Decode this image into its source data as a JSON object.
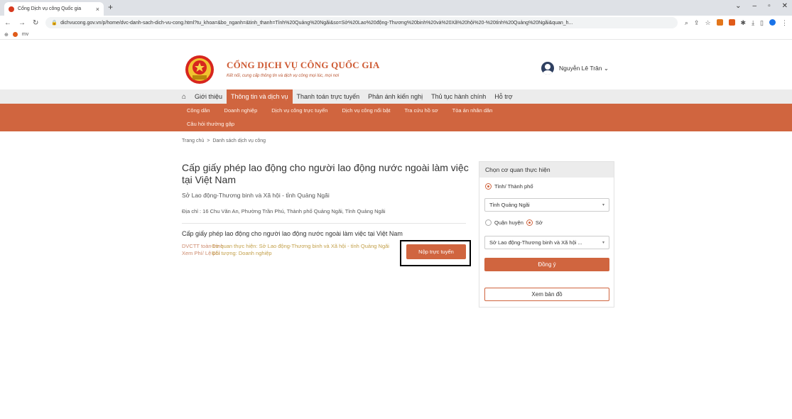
{
  "browser": {
    "tab_title": "Cổng Dịch vụ công Quốc gia",
    "tab_close": "×",
    "new_tab": "+",
    "url": "dichvucong.gov.vn/p/home/dvc-danh-sach-dich-vu-cong.html?tu_khoa=&bo_nganh=&tinh_thanh=Tỉnh%20Quảng%20Ngãi&so=Sở%20Lao%20động-Thương%20binh%20và%20Xã%20hội%20-%20tỉnh%20Quảng%20Ngãi&quan_h...",
    "bookmark_label": "mv"
  },
  "header": {
    "brand_title": "CỔNG DỊCH VỤ CÔNG QUỐC GIA",
    "brand_subtitle": "Kết nối, cung cấp thông tin và dịch vụ công mọi lúc, mọi nơi",
    "user_name": "Nguyễn Lê Trân ⌄"
  },
  "main_nav": {
    "items": [
      "Giới thiệu",
      "Thông tin và dịch vụ",
      "Thanh toán trực tuyến",
      "Phản ánh kiến nghị",
      "Thủ tục hành chính",
      "Hỗ trợ"
    ]
  },
  "sub_nav": {
    "row1": [
      "Công dân",
      "Doanh nghiệp",
      "Dịch vụ công trực tuyến",
      "Dịch vụ công nổi bật",
      "Tra cứu hồ sơ",
      "Tòa án nhân dân"
    ],
    "row2": [
      "Câu hỏi thường gặp"
    ]
  },
  "breadcrumb": {
    "home": "Trang chủ",
    "sep": ">",
    "current": "Danh sách dịch vụ công"
  },
  "service": {
    "title": "Cấp giấy phép lao động cho người lao động nước ngoài làm việc tại Việt Nam",
    "agency": "Sở Lao động-Thương binh và Xã hội - tỉnh Quảng Ngãi",
    "address": "Địa chỉ : 16 Chu Văn An, Phường Trần Phú, Thành phố Quảng Ngãi, Tỉnh Quảng Ngãi",
    "procedure_title": "Cấp giấy phép lao động cho người lao động nước ngoài làm việc tại Việt Nam",
    "dvctt_label": "DVCTT toàn trình",
    "fee_label": "Xem Phí/ Lệ phí",
    "agency_line": "Cơ quan thực hiện: Sở Lao động-Thương binh và Xã hội - tỉnh Quảng Ngãi",
    "target_line": "Đối tượng: Doanh nghiệp",
    "submit_button": "Nộp trực tuyến"
  },
  "panel": {
    "heading": "Chọn cơ quan thực hiện",
    "radio_province": "Tỉnh/ Thành phố",
    "province_select": "Tỉnh Quảng Ngãi",
    "radio_district": "Quận huyện",
    "radio_department": "Sở",
    "department_select": "Sở Lao động-Thương binh và Xã hội ...",
    "agree_button": "Đồng ý",
    "map_button": "Xem bản đồ"
  },
  "colors": {
    "accent": "#d0653f",
    "nav_bg": "#ececec"
  }
}
